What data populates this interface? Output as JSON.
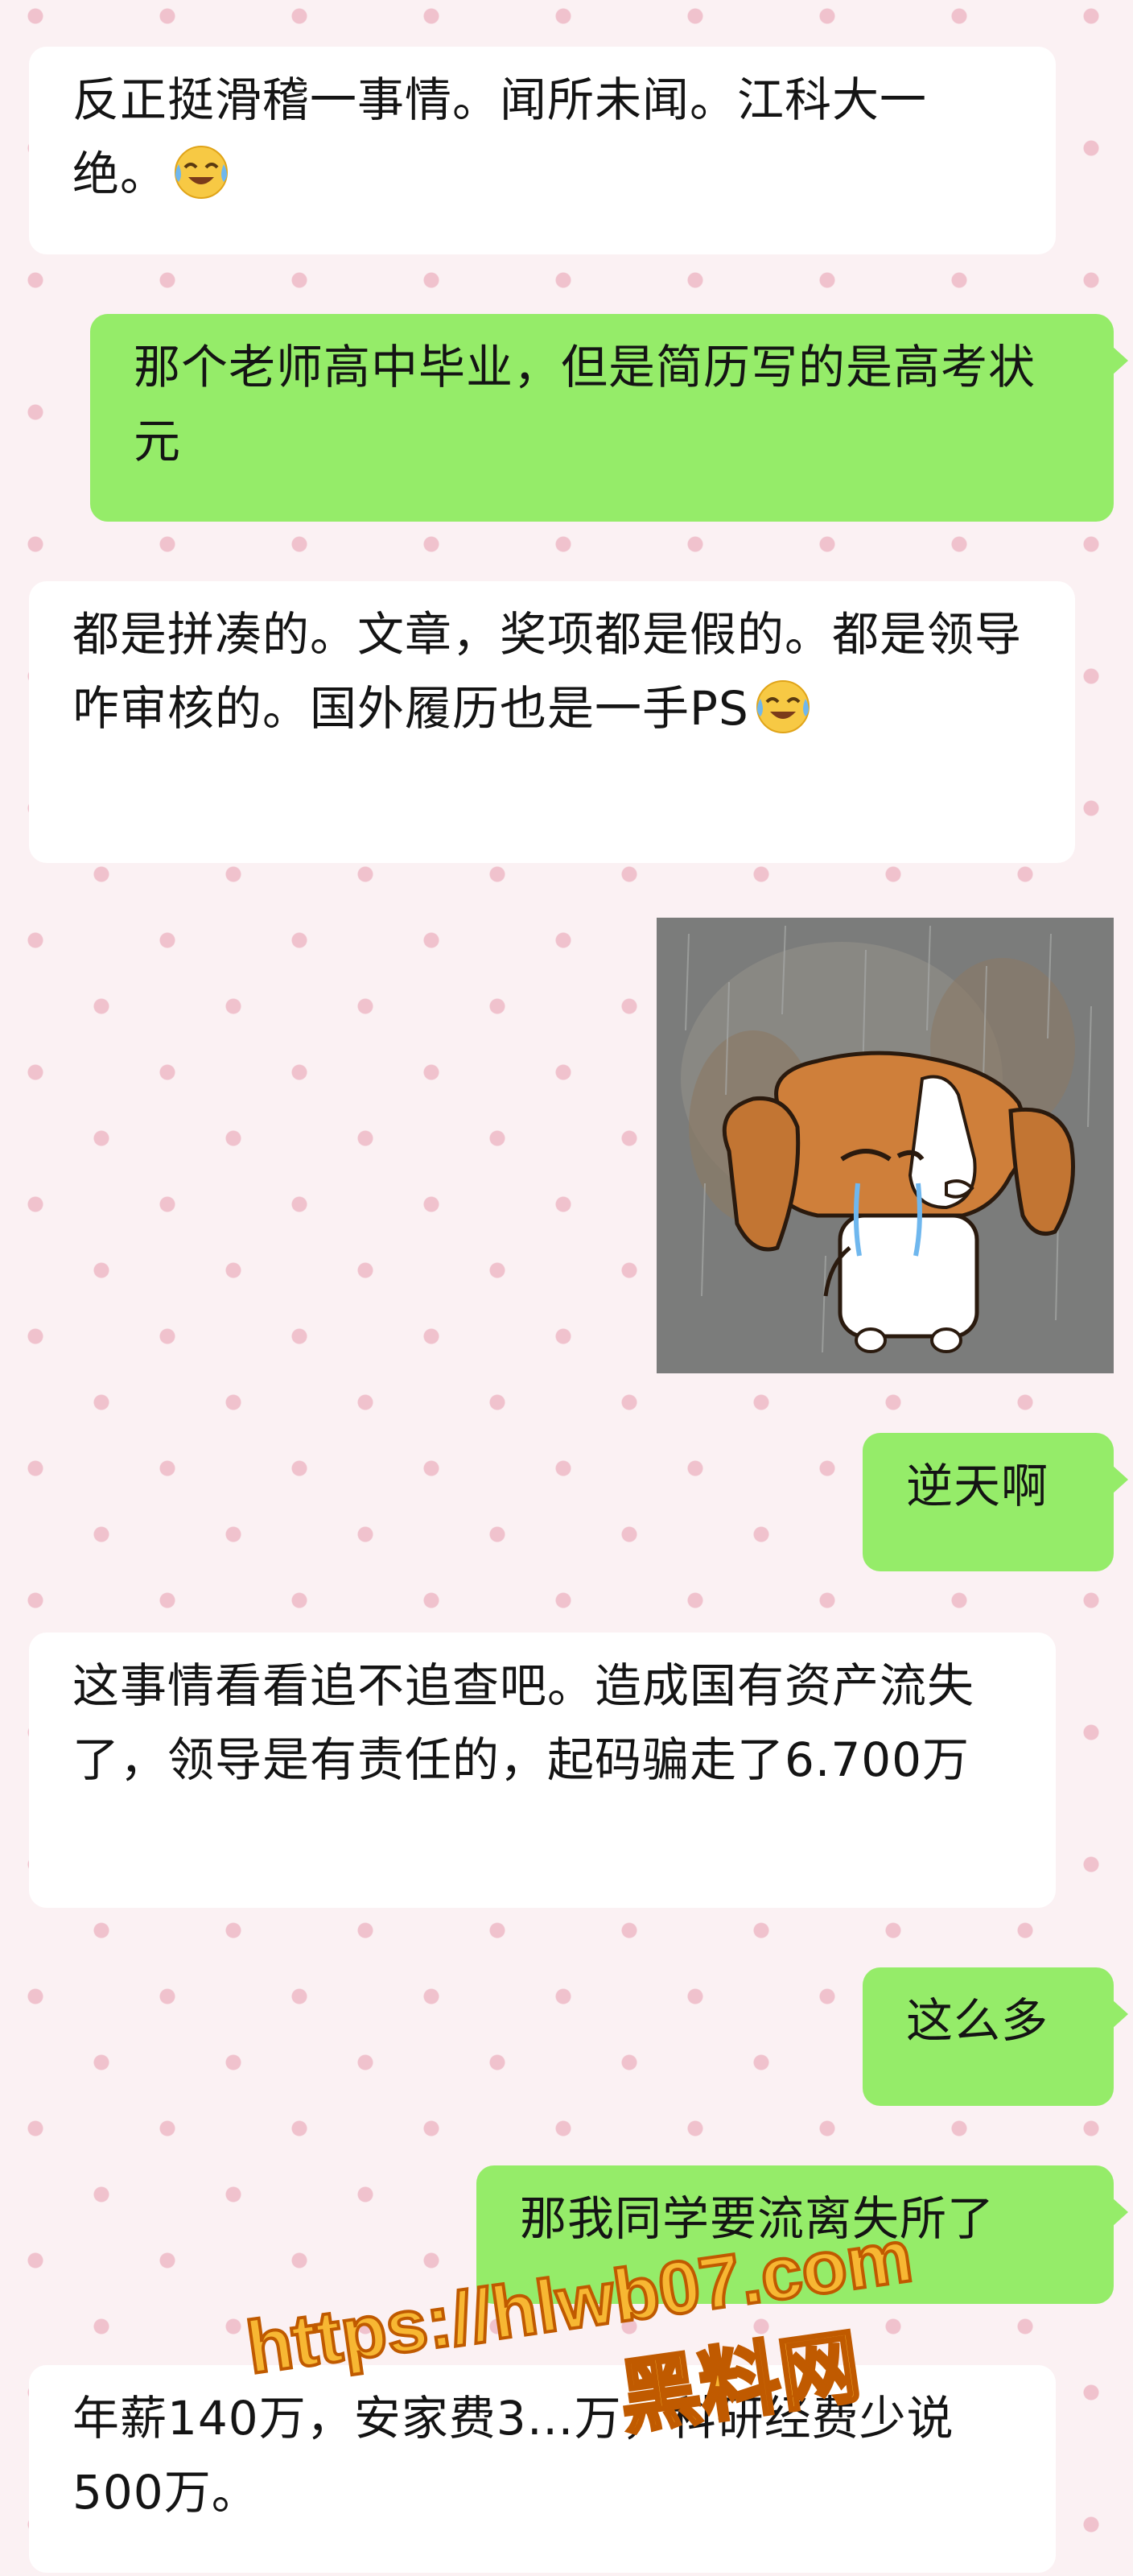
{
  "messages": [
    {
      "side": "left",
      "text": "反正挺滑稽一事情。闻所未闻。江科大一绝。",
      "emoji": "face-with-tears-of-joy-icon"
    },
    {
      "side": "right",
      "text": "那个老师高中毕业，但是简历写的是高考状元"
    },
    {
      "side": "left",
      "text": "都是拼凑的。文章，奖项都是假的。都是领导咋审核的。国外履历也是一手PS",
      "emoji": "face-with-tears-of-joy-icon"
    },
    {
      "side": "right",
      "type": "sticker",
      "sticker": "crying-dog-in-rain-sticker"
    },
    {
      "side": "right",
      "text": "逆天啊"
    },
    {
      "side": "left",
      "text": "这事情看看追不追查吧。造成国有资产流失了，领导是有责任的，起码骗走了6.700万"
    },
    {
      "side": "right",
      "text": "这么多"
    },
    {
      "side": "right",
      "text": "那我同学要流离失所了"
    },
    {
      "side": "left",
      "text": "年薪140万，安家费3…万，科研经费少说500万。"
    }
  ],
  "watermark": {
    "url": "https://hlwb07.com",
    "name": "黑料网"
  },
  "colors": {
    "incoming_bubble": "#ffffff",
    "outgoing_bubble": "#95ec69",
    "background": "#fbf1f3",
    "dots": "#f0c2cd",
    "watermark_fill": "#f7b733",
    "watermark_stroke": "#c05a00"
  }
}
